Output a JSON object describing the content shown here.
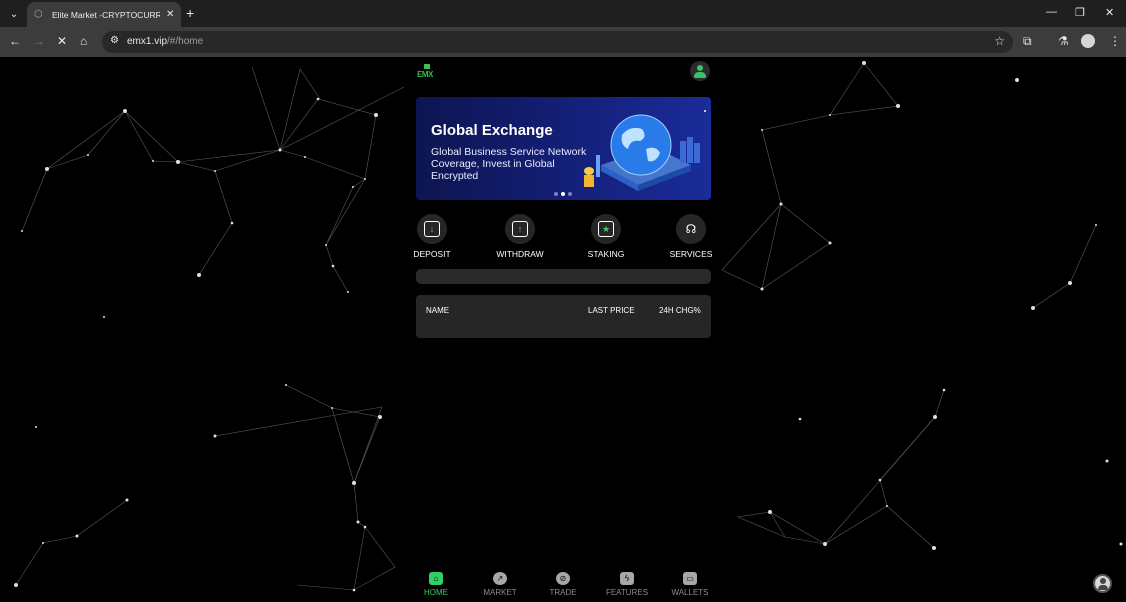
{
  "browser": {
    "tab_title": "Elite Market -CRYPTOCURRENC",
    "url_host": "emx1.vip",
    "url_path": "/#/home"
  },
  "header": {
    "logo_text": "EMX"
  },
  "banner": {
    "title": "Global Exchange",
    "subtitle": "Global Business Service Network Coverage, Invest in Global Encrypted",
    "slides": 3,
    "active_slide": 2
  },
  "quick_actions": [
    {
      "label": "DEPOSIT",
      "icon": "deposit-icon"
    },
    {
      "label": "WITHDRAW",
      "icon": "withdraw-icon"
    },
    {
      "label": "STAKING",
      "icon": "staking-icon"
    },
    {
      "label": "SERVICES",
      "icon": "headset-icon"
    }
  ],
  "market_table": {
    "col_name": "NAME",
    "col_price": "LAST PRICE",
    "col_change": "24H CHG%"
  },
  "bottom_nav": [
    {
      "label": "HOME",
      "icon": "home-icon",
      "active": true
    },
    {
      "label": "MARKET",
      "icon": "chart-icon",
      "active": false
    },
    {
      "label": "TRADE",
      "icon": "compass-icon",
      "active": false
    },
    {
      "label": "FEATURES",
      "icon": "lightning-icon",
      "active": false
    },
    {
      "label": "WALLETS",
      "icon": "wallet-icon",
      "active": false
    }
  ],
  "colors": {
    "accent": "#2fd162",
    "background": "#000000",
    "card": "#262626",
    "banner_blue": "#14207a"
  }
}
